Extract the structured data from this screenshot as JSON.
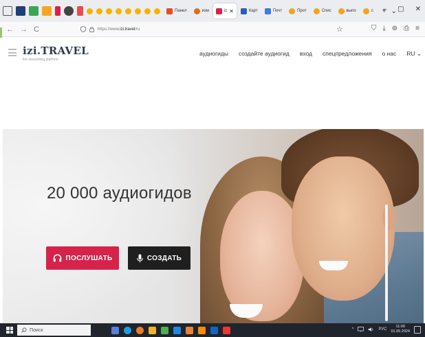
{
  "browser": {
    "tabs": [
      {
        "label": "Панел",
        "color": "#e44d26"
      },
      {
        "label": "изм",
        "color": "#e06d1a"
      },
      {
        "label": "iz",
        "color": "#d5234b",
        "active": true
      },
      {
        "label": "Карт",
        "color": "#2f5db3"
      },
      {
        "label": "Почт",
        "color": "#3b7de0"
      },
      {
        "label": "Прот",
        "color": "#f2a41e"
      },
      {
        "label": "Спис",
        "color": "#f2a41e"
      },
      {
        "label": "выпо",
        "color": "#f2a41e"
      },
      {
        "label": "с",
        "color": "#f2a41e"
      }
    ],
    "active_tab_close": "✕",
    "new_tab": "+",
    "tab_list": "⌄",
    "win_controls": {
      "minimize": "–",
      "maximize": "▢",
      "close": "✕"
    },
    "nav": {
      "back": "←",
      "forward": "→",
      "reload": "C"
    },
    "address": {
      "prefix": "https://www.",
      "domain": "izi.travel",
      "path": "/ru"
    },
    "bookmark_star": "☆",
    "toolbar_icons": [
      "⛉",
      "⤓",
      "⊚",
      "⎙",
      "≡"
    ]
  },
  "site": {
    "logo": {
      "text": "izi.TRAVEL",
      "tagline": "the storytelling platform"
    },
    "menu": [
      "аудиогиды",
      "создайте аудиогид",
      "вход",
      "спецпредложения",
      "о нас",
      "RU"
    ],
    "menu_caret": "⌄",
    "hero": {
      "title": "20 000 аудиогидов",
      "listen_button": "ПОСЛУШАТЬ",
      "create_button": "СОЗДАТЬ"
    }
  },
  "taskbar": {
    "search_placeholder": "Поиск",
    "apps": [
      "#5b7fd9",
      "#1e9de1",
      "#e97d2a",
      "#f0b429",
      "#4caf50",
      "#1e88e5",
      "#e8833a",
      "#ff8c00",
      "#1565c0",
      "#e53935"
    ],
    "tray": {
      "lang": "РУС",
      "chevron": "^",
      "time": "11:00",
      "date": "01.05.2024"
    }
  },
  "colors": {
    "accent_red": "#d5234b",
    "create_dark": "#1f1f1f",
    "logo_navy": "#2f3b4f"
  }
}
